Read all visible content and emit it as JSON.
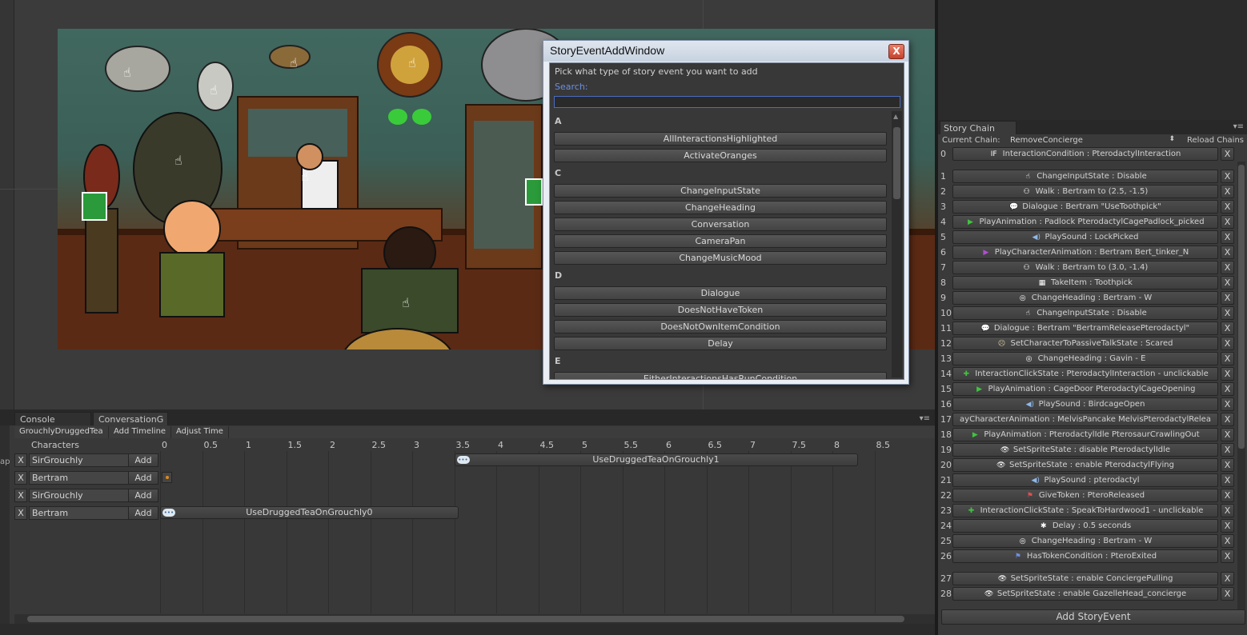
{
  "dialog": {
    "title": "StoryEventAddWindow",
    "close_label": "X",
    "prompt": "Pick what type of story event you want to add",
    "search_label": "Search:",
    "search_value": "",
    "groups": [
      {
        "letter": "A",
        "items": [
          "AllInteractionsHighlighted",
          "ActivateOranges"
        ]
      },
      {
        "letter": "C",
        "items": [
          "ChangeInputState",
          "ChangeHeading",
          "Conversation",
          "CameraPan",
          "ChangeMusicMood"
        ]
      },
      {
        "letter": "D",
        "items": [
          "Dialogue",
          "DoesNotHaveToken",
          "DoesNotOwnItemCondition",
          "Delay"
        ]
      },
      {
        "letter": "E",
        "items": [
          "EitherInteractionsHasRunCondition"
        ]
      }
    ]
  },
  "story_chain": {
    "tab_label": "Story Chain",
    "menu_glyph": "▾≡",
    "current_chain_label": "Current Chain:",
    "current_chain_value": "RemoveConcierge",
    "reload_label": "Reload Chains",
    "add_label": "Add StoryEvent",
    "remove_label": "X",
    "rows": [
      {
        "index": "0",
        "icon": "IF",
        "icon_color": "#ffffff",
        "text": "InteractionCondition :  PterodactylInteraction"
      },
      {
        "index": "1",
        "icon": "☝",
        "icon_color": "#ffffff",
        "text": "ChangeInputState :  Disable"
      },
      {
        "index": "2",
        "icon": "⚇",
        "icon_color": "#ffffff",
        "text": "Walk :  Bertram to (2.5, -1.5)"
      },
      {
        "index": "3",
        "icon": "💬",
        "icon_color": "#ffffff",
        "text": "Dialogue :  Bertram \"UseToothpick\""
      },
      {
        "index": "4",
        "icon": "▶",
        "icon_color": "#3fc43f",
        "text": "PlayAnimation :  Padlock PterodactylCagePadlock_picked"
      },
      {
        "index": "5",
        "icon": "◀)",
        "icon_color": "#8fb8e8",
        "text": "PlaySound :  LockPicked"
      },
      {
        "index": "6",
        "icon": "▶",
        "icon_color": "#b04fd0",
        "text": "PlayCharacterAnimation :  Bertram Bert_tinker_N"
      },
      {
        "index": "7",
        "icon": "⚇",
        "icon_color": "#ffffff",
        "text": "Walk :  Bertram to (3.0, -1.4)"
      },
      {
        "index": "8",
        "icon": "▦",
        "icon_color": "#ffffff",
        "text": "TakeItem :  Toothpick"
      },
      {
        "index": "9",
        "icon": "◎",
        "icon_color": "#ffffff",
        "text": "ChangeHeading :  Bertram - W"
      },
      {
        "index": "10",
        "icon": "☝",
        "icon_color": "#ffffff",
        "text": "ChangeInputState :  Disable"
      },
      {
        "index": "11",
        "icon": "💬",
        "icon_color": "#ffffff",
        "text": "Dialogue :  Bertram \"BertramReleasePterodactyl\""
      },
      {
        "index": "12",
        "icon": "☹",
        "icon_color": "#d8c8a0",
        "text": "SetCharacterToPassiveTalkState :  Scared"
      },
      {
        "index": "13",
        "icon": "◎",
        "icon_color": "#ffffff",
        "text": "ChangeHeading :  Gavin - E"
      },
      {
        "index": "14",
        "icon": "✚",
        "icon_color": "#3fc43f",
        "text": "InteractionClickState :  PterodactylInteraction - unclickable"
      },
      {
        "index": "15",
        "icon": "▶",
        "icon_color": "#3fc43f",
        "text": "PlayAnimation :  CageDoor PterodactylCageOpening"
      },
      {
        "index": "16",
        "icon": "◀)",
        "icon_color": "#8fb8e8",
        "text": "PlaySound :  BirdcageOpen"
      },
      {
        "index": "17",
        "icon": "",
        "icon_color": "#ffffff",
        "text": "ayCharacterAnimation :  MelvisPancake MelvisPterodactylRelea"
      },
      {
        "index": "18",
        "icon": "▶",
        "icon_color": "#3fc43f",
        "text": "PlayAnimation :  PterodactylIdle PterosaurCrawlingOut"
      },
      {
        "index": "19",
        "icon": "👁",
        "icon_color": "#ffffff",
        "text": "SetSpriteState :  disable PterodactylIdle"
      },
      {
        "index": "20",
        "icon": "👁",
        "icon_color": "#ffffff",
        "text": "SetSpriteState :  enable PterodactylFlying"
      },
      {
        "index": "21",
        "icon": "◀)",
        "icon_color": "#8fb8e8",
        "text": "PlaySound :  pterodactyl"
      },
      {
        "index": "22",
        "icon": "⚑",
        "icon_color": "#e05050",
        "text": "GiveToken :  PteroReleased"
      },
      {
        "index": "23",
        "icon": "✚",
        "icon_color": "#3fc43f",
        "text": "InteractionClickState :  SpeakToHardwood1 - unclickable"
      },
      {
        "index": "24",
        "icon": "✱",
        "icon_color": "#ffffff",
        "text": "Delay :  0.5 seconds"
      },
      {
        "index": "25",
        "icon": "◎",
        "icon_color": "#ffffff",
        "text": "ChangeHeading :  Bertram - W"
      },
      {
        "index": "26",
        "icon": "⚑",
        "icon_color": "#6f8fe0",
        "text": "HasTokenCondition :  PteroExited"
      },
      {
        "index": "27",
        "icon": "👁",
        "icon_color": "#ffffff",
        "text": "SetSpriteState :  enable ConciergePulling"
      },
      {
        "index": "28",
        "icon": "👁",
        "icon_color": "#ffffff",
        "text": "SetSpriteState :  enable GazelleHead_concierge"
      }
    ]
  },
  "timeline": {
    "tabs": [
      "Console",
      "ConversationG"
    ],
    "menu_glyph": "▾≡",
    "side_label": "ap",
    "toolbar": [
      "GrouchlyDruggedTea",
      "Add Timeline",
      "Adjust Time"
    ],
    "characters_label": "Characters",
    "ruler": [
      "0",
      "0.5",
      "1",
      "1.5",
      "2",
      "2.5",
      "3",
      "3.5",
      "4",
      "4.5",
      "5",
      "5.5",
      "6",
      "6.5",
      "7",
      "7.5",
      "8",
      "8.5"
    ],
    "remove_label": "X",
    "add_label": "Add",
    "rows": [
      {
        "name": "SirGrouchly"
      },
      {
        "name": "Bertram"
      },
      {
        "name": "SirGrouchly"
      },
      {
        "name": "Bertram"
      }
    ],
    "events": [
      {
        "label": "UseDruggedTeaOnGrouchly1",
        "row": 0,
        "start": 3.5,
        "end": 8.3
      },
      {
        "label": "UseDruggedTeaOnGrouchly0",
        "row": 3,
        "start": 0.0,
        "end": 3.55
      }
    ]
  },
  "colors": {
    "accent_blue": "#6c8fe0",
    "close_red": "#c7412c",
    "panel_bg": "#383838"
  }
}
